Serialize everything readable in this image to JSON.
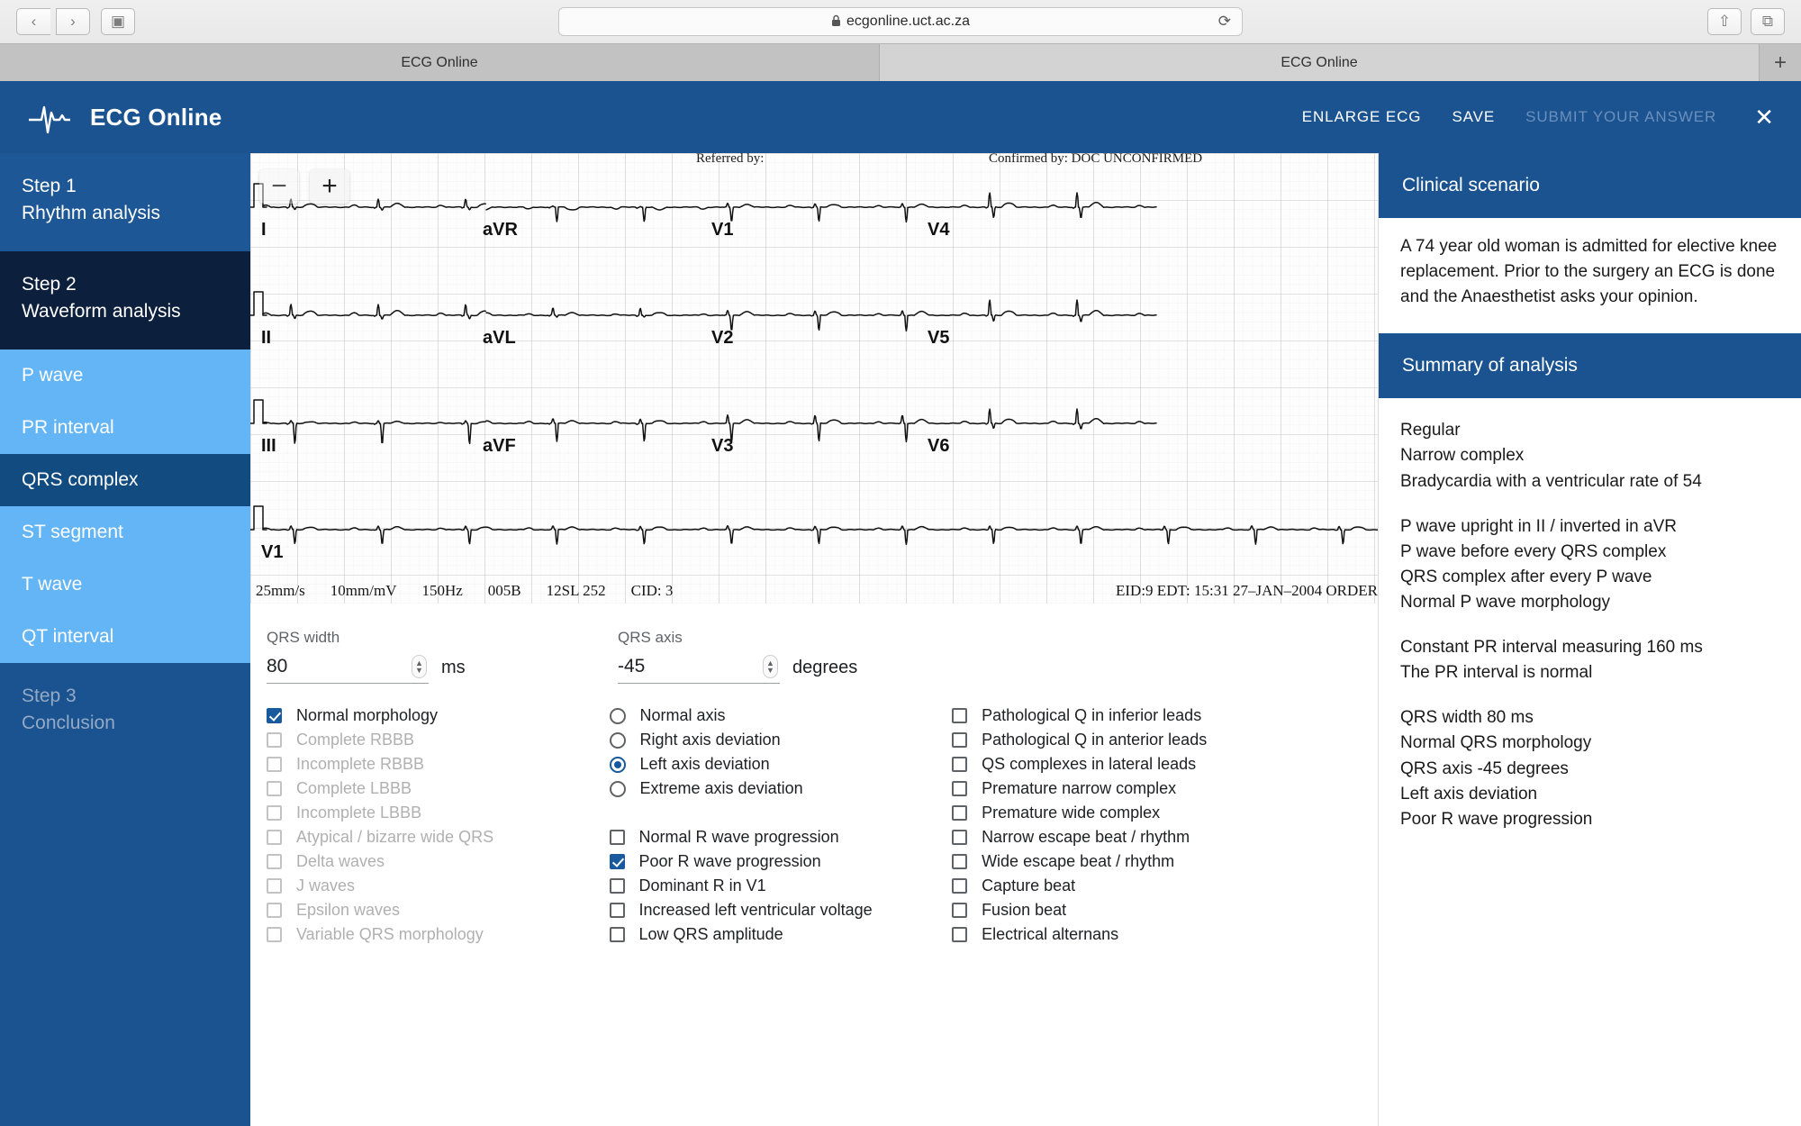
{
  "browser": {
    "back_icon": "‹",
    "forward_icon": "›",
    "sidebar_icon": "▣",
    "lock_icon": "🔒",
    "url": "ecgonline.uct.ac.za",
    "reload_icon": "⟳",
    "share_icon": "⇧",
    "tabs_icon": "⧉",
    "new_tab_icon": "+",
    "tabs": [
      {
        "label": "ECG Online",
        "active": false
      },
      {
        "label": "ECG Online",
        "active": true
      }
    ]
  },
  "header": {
    "title": "ECG Online",
    "logo_name": "ecg-waveform-logo",
    "actions": [
      {
        "label": "ENLARGE ECG",
        "disabled": false
      },
      {
        "label": "SAVE",
        "disabled": false
      },
      {
        "label": "SUBMIT YOUR ANSWER",
        "disabled": true
      }
    ],
    "close_label": "✕",
    "brand_color": "#1b5390"
  },
  "sidebar": {
    "steps": [
      {
        "title": "Step 1",
        "subtitle": "Rhythm analysis",
        "state": "available"
      },
      {
        "title": "Step 2",
        "subtitle": "Waveform analysis",
        "state": "active"
      },
      {
        "title": "Step 3",
        "subtitle": "Conclusion",
        "state": "disabled"
      }
    ],
    "substeps": [
      {
        "label": "P wave",
        "selected": false
      },
      {
        "label": "PR interval",
        "selected": false
      },
      {
        "label": "QRS complex",
        "selected": true
      },
      {
        "label": "ST segment",
        "selected": false
      },
      {
        "label": "T wave",
        "selected": false
      },
      {
        "label": "QT interval",
        "selected": false
      }
    ]
  },
  "ecg": {
    "zoom_out_label": "−",
    "zoom_in_label": "+",
    "top_meta_left": "Referred by:",
    "top_meta_right": "Confirmed by: DOC UNCONFIRMED",
    "leads": [
      "I",
      "aVR",
      "V1",
      "V4",
      "II",
      "aVL",
      "V2",
      "V5",
      "III",
      "aVF",
      "V3",
      "V6",
      "V1"
    ],
    "footer_left": [
      "25mm/s",
      "10mm/mV",
      "150Hz",
      "005B",
      "12SL 252",
      "CID: 3"
    ],
    "footer_right": "EID:9 EDT: 15:31 27–JAN–2004 ORDER"
  },
  "form": {
    "qrs_width": {
      "label": "QRS width",
      "value": "80",
      "unit": "ms"
    },
    "qrs_axis": {
      "label": "QRS axis",
      "value": "-45",
      "unit": "degrees"
    },
    "morphology_options": [
      {
        "label": "Normal morphology",
        "checked": true,
        "disabled": false
      },
      {
        "label": "Complete RBBB",
        "checked": false,
        "disabled": true
      },
      {
        "label": "Incomplete RBBB",
        "checked": false,
        "disabled": true
      },
      {
        "label": "Complete LBBB",
        "checked": false,
        "disabled": true
      },
      {
        "label": "Incomplete LBBB",
        "checked": false,
        "disabled": true
      },
      {
        "label": "Atypical / bizarre wide QRS",
        "checked": false,
        "disabled": true
      },
      {
        "label": "Delta waves",
        "checked": false,
        "disabled": true
      },
      {
        "label": "J waves",
        "checked": false,
        "disabled": true
      },
      {
        "label": "Epsilon waves",
        "checked": false,
        "disabled": true
      },
      {
        "label": "Variable QRS morphology",
        "checked": false,
        "disabled": true
      }
    ],
    "axis_options": [
      {
        "label": "Normal axis",
        "selected": false
      },
      {
        "label": "Right axis deviation",
        "selected": false
      },
      {
        "label": "Left axis deviation",
        "selected": true
      },
      {
        "label": "Extreme axis deviation",
        "selected": false
      }
    ],
    "rwave_options": [
      {
        "label": "Normal R wave progression",
        "checked": false
      },
      {
        "label": "Poor R wave progression",
        "checked": true
      },
      {
        "label": "Dominant R in V1",
        "checked": false
      },
      {
        "label": "Increased left ventricular voltage",
        "checked": false
      },
      {
        "label": "Low QRS amplitude",
        "checked": false
      }
    ],
    "pathology_options": [
      {
        "label": "Pathological Q in inferior leads",
        "checked": false
      },
      {
        "label": "Pathological Q in anterior leads",
        "checked": false
      },
      {
        "label": "QS complexes in lateral leads",
        "checked": false
      },
      {
        "label": "Premature narrow complex",
        "checked": false
      },
      {
        "label": "Premature wide complex",
        "checked": false
      },
      {
        "label": "Narrow escape beat / rhythm",
        "checked": false
      },
      {
        "label": "Wide escape beat / rhythm",
        "checked": false
      },
      {
        "label": "Capture beat",
        "checked": false
      },
      {
        "label": "Fusion beat",
        "checked": false
      },
      {
        "label": "Electrical alternans",
        "checked": false
      }
    ]
  },
  "right_panel": {
    "scenario_title": "Clinical scenario",
    "scenario_text": "A 74 year old woman is admitted for elective knee replacement. Prior to the surgery an ECG is done and the Anaesthetist asks your opinion.",
    "summary_title": "Summary of analysis",
    "summary_lines": [
      "Regular",
      "Narrow complex",
      "Bradycardia with a ventricular rate of 54",
      "",
      "P wave upright in II / inverted in aVR",
      "P wave before every QRS complex",
      "QRS complex after every P wave",
      "Normal P wave morphology",
      "",
      "Constant PR interval measuring 160 ms",
      "The PR interval is normal",
      "",
      "QRS width 80 ms",
      "Normal QRS morphology",
      "QRS axis -45 degrees",
      "Left axis deviation",
      "Poor R wave progression"
    ]
  }
}
